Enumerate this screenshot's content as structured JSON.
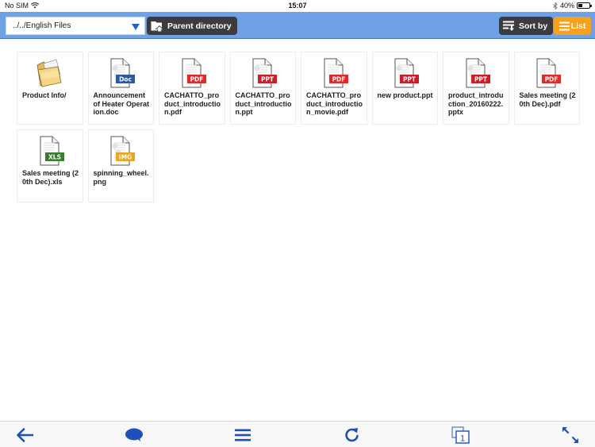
{
  "status_bar": {
    "carrier": "No SIM",
    "time": "15:07",
    "battery_percent": "40%",
    "battery_level": 0.4
  },
  "toolbar": {
    "path_value": "../../English Files",
    "parent_directory_label": "Parent directory",
    "sort_by_label": "Sort by",
    "list_label": "List"
  },
  "colors": {
    "toolbar_bg": "#6fa1e4",
    "dark_button": "#3c3c3e",
    "list_button": "#f7a11c",
    "accent_blue": "#1f4fb8",
    "doc_badge": "#2d5aa8",
    "pdf_badge": "#e02a2a",
    "ppt_badge": "#c8202a",
    "xls_badge": "#3a7d2e",
    "img_badge": "#e9a523"
  },
  "files": [
    {
      "name": "Product Info/",
      "type": "folder",
      "badge": ""
    },
    {
      "name": "Announcement of Heater Operation.doc",
      "type": "doc",
      "badge": "Doc"
    },
    {
      "name": "CACHATTO_product_introduction.pdf",
      "type": "pdf",
      "badge": "PDF"
    },
    {
      "name": "CACHATTO_product_introduction.ppt",
      "type": "ppt",
      "badge": "PPT"
    },
    {
      "name": "CACHATTO_product_introduction_movie.pdf",
      "type": "pdf",
      "badge": "PDF"
    },
    {
      "name": "new product.ppt",
      "type": "ppt",
      "badge": "PPT"
    },
    {
      "name": "product_introduction_20160222.pptx",
      "type": "ppt",
      "badge": "PPT"
    },
    {
      "name": "Sales meeting (20th Dec).pdf",
      "type": "pdf",
      "badge": "PDF"
    },
    {
      "name": "Sales meeting (20th Dec).xls",
      "type": "xls",
      "badge": "XLS"
    },
    {
      "name": "spinning_wheel.png",
      "type": "img",
      "badge": "IMG"
    }
  ],
  "bottom_bar": {
    "items": [
      {
        "id": "back",
        "icon": "arrow-left-icon"
      },
      {
        "id": "comment",
        "icon": "speech-bubble-icon"
      },
      {
        "id": "menu",
        "icon": "hamburger-menu-icon"
      },
      {
        "id": "refresh",
        "icon": "refresh-icon"
      },
      {
        "id": "windows",
        "icon": "windows-icon",
        "count": "1"
      },
      {
        "id": "fullscreen",
        "icon": "expand-icon"
      }
    ]
  }
}
